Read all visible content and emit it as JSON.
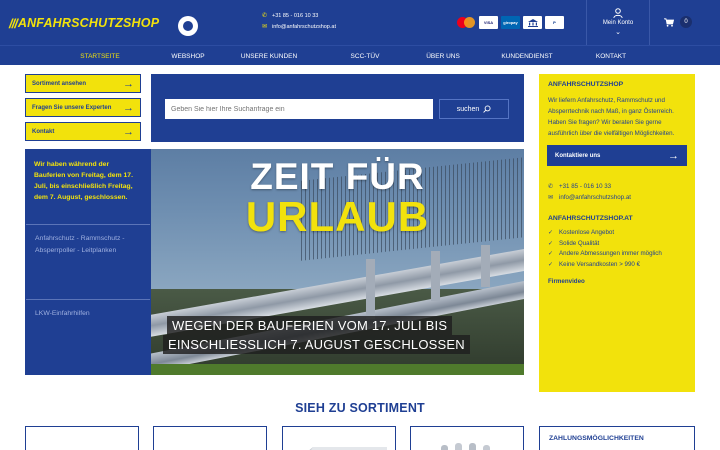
{
  "header": {
    "logo_bars": "///",
    "logo_text": "ANFAHRSCHUTZSHOP",
    "phone": "+31 85 - 016 10 33",
    "email": "info@anfahrschutzshop.at",
    "payments": [
      "MC",
      "VISA",
      "giropay",
      "bank",
      "P"
    ],
    "account_label": "Mein Konto",
    "cart_count": "0",
    "brand_color": "#1f3f93",
    "accent_color": "#f2e20c"
  },
  "nav": {
    "items": [
      {
        "label": "STARTSEITE"
      },
      {
        "label": "WEBSHOP"
      },
      {
        "label": "UNSERE KUNDEN"
      },
      {
        "label": "SCC-TÜV"
      },
      {
        "label": "ÜBER UNS"
      },
      {
        "label": "KUNDENDIENST"
      },
      {
        "label": "KONTAKT"
      }
    ]
  },
  "sidebar": {
    "buttons": [
      {
        "label": "Sortiment ansehen"
      },
      {
        "label": "Fragen Sie unsere Experten"
      },
      {
        "label": "Kontakt"
      }
    ],
    "notice": "Wir haben während der Bauferien von Freitag, dem 17. Juli, bis einschließlich Freitag, dem 7. August, geschlossen.",
    "categories": [
      {
        "label": "Anfahrschutz - Rammschutz - Absperrpoller - Leitplanken"
      },
      {
        "label": "LKW-Einfahrhilfen"
      }
    ]
  },
  "search": {
    "placeholder": "Geben Sie hier Ihre Suchanfrage ein",
    "button_label": "suchen"
  },
  "hero": {
    "title_line1": "ZEIT FÜR",
    "title_line2": "URLAUB",
    "caption_line1": "WEGEN DER BAUFERIEN VOM 17. JULI BIS",
    "caption_line2": "EINSCHLIESSLICH 7. AUGUST GESCHLOSSEN"
  },
  "info_panel": {
    "title": "ANFAHRSCHUTZSHOP",
    "text": "Wir liefern Anfahrschutz, Rammschutz und Absperrtechnik nach Maß, in ganz Österreich. Haben Sie fragen? Wir beraten Sie gerne ausführlich über die vielfältigen Möglichkeiten.",
    "button_label": "Kontaktiere uns",
    "phone": "+31 85 - 016 10 33",
    "email": "info@anfahrschutzshop.at",
    "usp_title": "ANFAHRSCHUTZSHOP.AT",
    "usps": [
      {
        "label": "Kostenlose Angebot"
      },
      {
        "label": "Solide Qualität"
      },
      {
        "label": "Andere Abmessungen immer möglich"
      },
      {
        "label": "Keine Versandkosten > 990 €"
      }
    ],
    "video_label": "Firmenvideo"
  },
  "products": {
    "section_title": "SIEH ZU SORTIMENT",
    "payment_title": "ZAHLUNGSMÖGLICHKEITEN"
  }
}
